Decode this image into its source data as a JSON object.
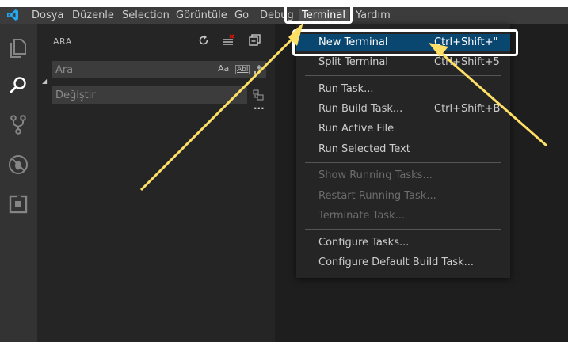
{
  "menubar": {
    "items": [
      {
        "label": "Dosya"
      },
      {
        "label": "Düzenle"
      },
      {
        "label": "Selection"
      },
      {
        "label": "Görüntüle"
      },
      {
        "label": "Go"
      },
      {
        "label": "Debug"
      },
      {
        "label": "Terminal"
      },
      {
        "label": "Yardım"
      }
    ],
    "active": "Terminal"
  },
  "activity_bar": {
    "icons": [
      "files-icon",
      "search-icon",
      "source-control-icon",
      "debug-icon",
      "extensions-icon"
    ],
    "active": "search-icon"
  },
  "sidebar": {
    "title": "ARA",
    "search_placeholder": "Ara",
    "replace_placeholder": "Değiştir",
    "match_case": "Aa",
    "whole_word": "Abl",
    "more": "···"
  },
  "terminal_menu": {
    "items": [
      {
        "label": "New Terminal",
        "shortcut": "Ctrl+Shift+\"",
        "state": "highlighted"
      },
      {
        "label": "Split Terminal",
        "shortcut": "Ctrl+Shift+5",
        "state": "enabled"
      },
      {
        "label": "Run Task...",
        "shortcut": "",
        "state": "enabled"
      },
      {
        "label": "Run Build Task...",
        "shortcut": "Ctrl+Shift+B",
        "state": "enabled"
      },
      {
        "label": "Run Active File",
        "shortcut": "",
        "state": "enabled"
      },
      {
        "label": "Run Selected Text",
        "shortcut": "",
        "state": "enabled"
      },
      {
        "label": "Show Running Tasks...",
        "shortcut": "",
        "state": "disabled"
      },
      {
        "label": "Restart Running Task...",
        "shortcut": "",
        "state": "disabled"
      },
      {
        "label": "Terminate Task...",
        "shortcut": "",
        "state": "disabled"
      },
      {
        "label": "Configure Tasks...",
        "shortcut": "",
        "state": "enabled"
      },
      {
        "label": "Configure Default Build Task...",
        "shortcut": "",
        "state": "enabled"
      }
    ]
  },
  "colors": {
    "menubar_bg": "#3c3c3c",
    "activity_bar_bg": "#333333",
    "sidebar_bg": "#252526",
    "editor_bg": "#1e1e1e",
    "menu_highlight": "#094771",
    "annotation_arrow": "#ffe066",
    "vscode_blue": "#007acc"
  }
}
